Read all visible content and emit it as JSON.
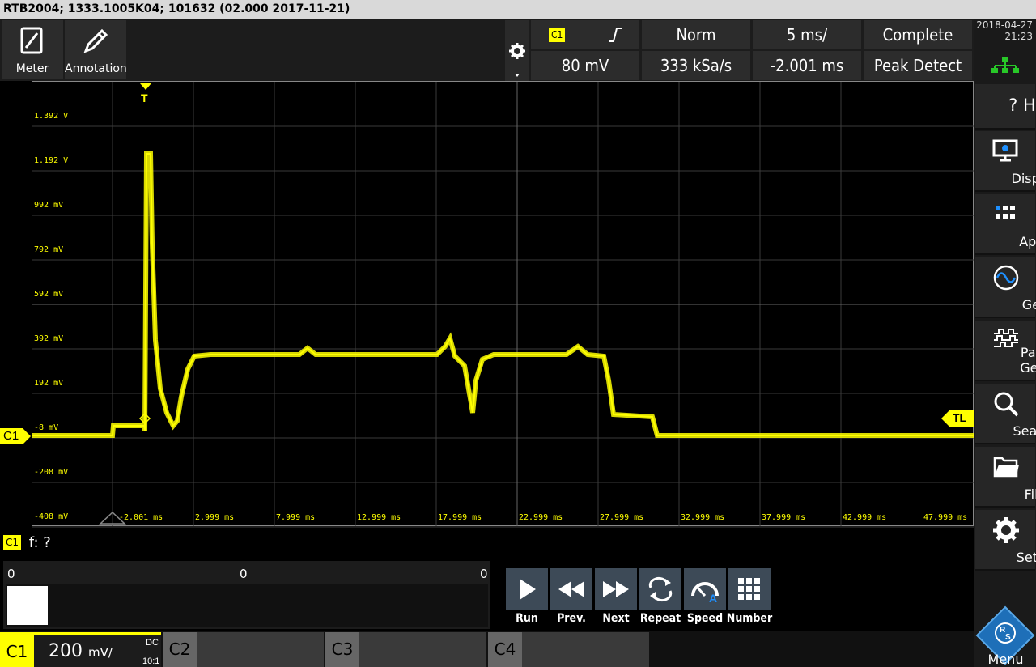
{
  "title": "RTB2004; 1333.1005K04; 101632 (02.000 2017-11-21)",
  "toolbar": {
    "meter_label": "Meter",
    "annotation_label": "Annotation"
  },
  "trigger": {
    "source": "C1",
    "level": "80 mV",
    "mode": "Norm",
    "sample_rate": "333 kSa/s",
    "timebase": "5 ms/",
    "position": "-2.001 ms",
    "acq_status": "Complete",
    "acq_mode": "Peak Detect"
  },
  "datetime": {
    "date": "2018-04-27",
    "time": "21:23"
  },
  "sidebar": {
    "items": [
      {
        "label": "? Help"
      },
      {
        "label": "Display"
      },
      {
        "label": "Apps"
      },
      {
        "label": "Gen"
      },
      {
        "label": "Patt. Gen."
      },
      {
        "label": "Search"
      },
      {
        "label": "File"
      },
      {
        "label": "Setup"
      },
      {
        "label": "Menu"
      }
    ]
  },
  "screen": {
    "y_labels": [
      "1.392 V",
      "1.192 V",
      "992 mV",
      "792 mV",
      "592 mV",
      "392 mV",
      "192 mV",
      "-8 mV",
      "-208 mV",
      "-408 mV"
    ],
    "x_labels": [
      "-2.001 ms",
      "2.999 ms",
      "7.999 ms",
      "12.999 ms",
      "17.999 ms",
      "22.999 ms",
      "27.999 ms",
      "32.999 ms",
      "37.999 ms",
      "42.999 ms",
      "47.999 ms"
    ],
    "channel_marker": "C1",
    "trigger_marker": "T",
    "tl_marker": "TL",
    "trace_color": "#ffff00"
  },
  "frequency": {
    "channel": "C1",
    "label": "f: ?"
  },
  "history": {
    "left": "0",
    "mid": "0",
    "right": "0",
    "position": 0.0
  },
  "controls": [
    {
      "label": "Run"
    },
    {
      "label": "Prev."
    },
    {
      "label": "Next"
    },
    {
      "label": "Repeat"
    },
    {
      "label": "Speed"
    },
    {
      "label": "Number"
    }
  ],
  "channels": [
    {
      "name": "C1",
      "scale": "200",
      "unit": "mV/",
      "coupling": "DC",
      "probe": "10:1"
    },
    {
      "name": "C2"
    },
    {
      "name": "C3"
    },
    {
      "name": "C4"
    }
  ]
}
